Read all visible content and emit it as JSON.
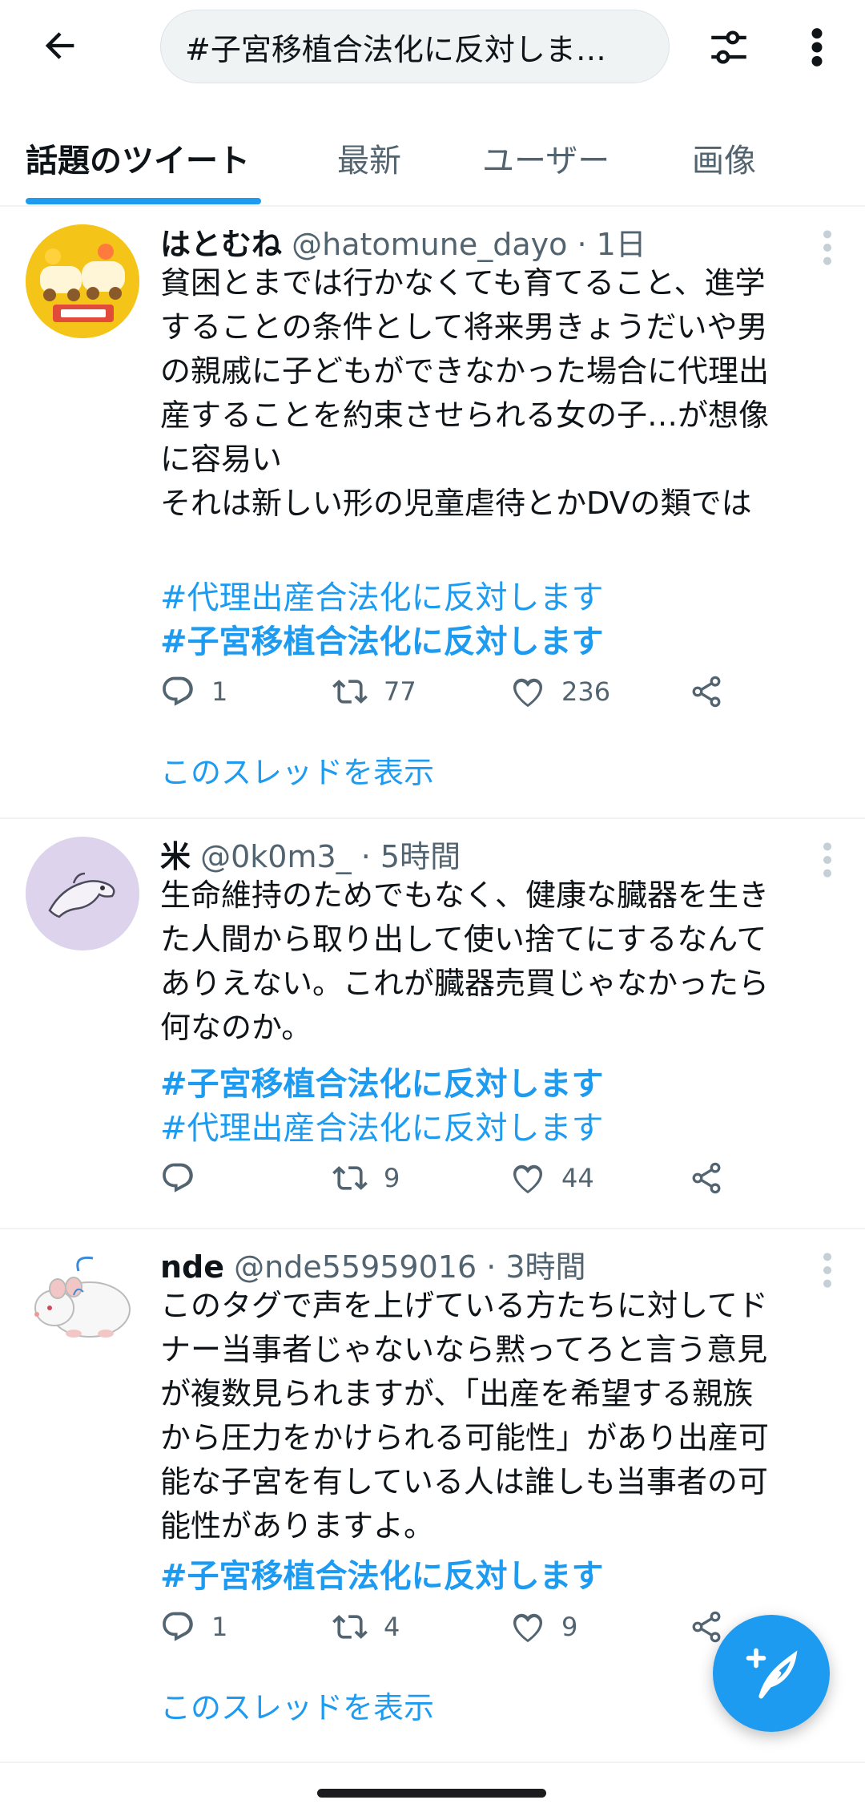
{
  "search": {
    "query": "#子宮移植合法化に反対しま…"
  },
  "tabs": [
    {
      "label": "話題のツイート",
      "active": true
    },
    {
      "label": "最新"
    },
    {
      "label": "ユーザー"
    },
    {
      "label": "画像"
    }
  ],
  "tweets": [
    {
      "name": "はとむね",
      "handle": "@hatomune_dayo",
      "time": "· 1日",
      "text": "貧困とまでは行かなくても育てること、進学\nすることの条件として将来男きょうだいや男\nの親戚に子どもができなかった場合に代理出\n産することを約束させられる女の子…が想像\nに容易い\nそれは新しい形の児童虐待とかDVの類では",
      "hashtags": [
        "#代理出産合法化に反対します",
        "#子宮移植合法化に反対します"
      ],
      "replies": "1",
      "retweets": "77",
      "likes": "236",
      "thread_link": "このスレッドを表示"
    },
    {
      "name": "米",
      "handle": "@0k0m3_",
      "time": "· 5時間",
      "text": "生命維持のためでもなく、健康な臓器を生き\nた人間から取り出して使い捨てにするなんて\nありえない。これが臓器売買じゃなかったら\n何なのか。",
      "hashtags": [
        "#子宮移植合法化に反対します",
        "#代理出産合法化に反対します"
      ],
      "replies": "",
      "retweets": "9",
      "likes": "44"
    },
    {
      "name": "nde",
      "handle": "@nde55959016",
      "time": "· 3時間",
      "text": "このタグで声を上げている方たちに対してド\nナー当事者じゃないなら黙ってろと言う意見\nが複数見られますが、「出産を希望する親族\nから圧力をかけられる可能性」があり出産可\n能な子宮を有している人は誰しも当事者の可\n能性がありますよ。",
      "hashtags": [
        "#子宮移植合法化に反対します"
      ],
      "replies": "1",
      "retweets": "4",
      "likes": "9",
      "thread_link": "このスレッドを表示"
    }
  ],
  "colors": {
    "accent": "#1d9bf0",
    "secondary_text": "#536471",
    "divider": "#eff3f4"
  },
  "icons": [
    "back-arrow-icon",
    "filter-icon",
    "more-vertical-icon",
    "reply-icon",
    "retweet-icon",
    "like-icon",
    "share-icon",
    "compose-tweet-icon"
  ]
}
